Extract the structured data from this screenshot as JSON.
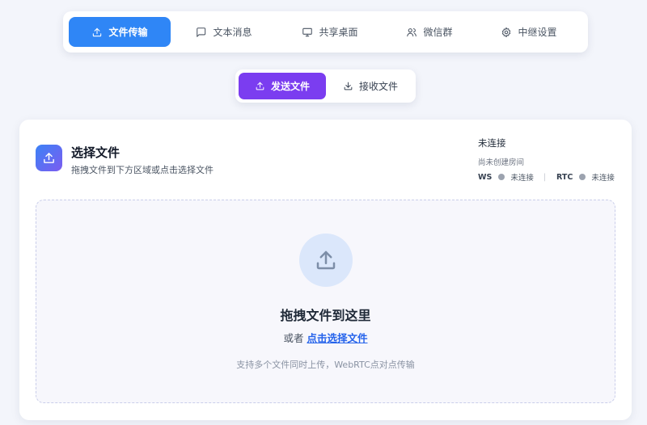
{
  "nav": {
    "items": [
      {
        "label": "文件传输",
        "icon": "upload-icon",
        "active": true
      },
      {
        "label": "文本消息",
        "icon": "message-square-icon",
        "active": false
      },
      {
        "label": "共享桌面",
        "icon": "monitor-icon",
        "active": false
      },
      {
        "label": "微信群",
        "icon": "users-icon",
        "active": false
      },
      {
        "label": "中继设置",
        "icon": "gear-icon",
        "active": false
      }
    ]
  },
  "modes": {
    "send_label": "发送文件",
    "receive_label": "接收文件",
    "active": "send"
  },
  "card": {
    "title": "选择文件",
    "subtitle": "拖拽文件到下方区域或点击选择文件",
    "status": {
      "title": "未连接",
      "room": "尚未创建房间",
      "ws_label": "WS",
      "ws_state": "未连接",
      "rtc_label": "RTC",
      "rtc_state": "未连接",
      "separator": "|"
    }
  },
  "dropzone": {
    "title": "拖拽文件到这里",
    "or_text": "或者",
    "link_text": "点击选择文件",
    "hint": "支持多个文件同时上传，WebRTC点对点传输"
  },
  "colors": {
    "nav_active": "#2f86f6",
    "mode_active": "#7b3df0",
    "link": "#2563eb",
    "status_dot": "#9ca3af"
  }
}
